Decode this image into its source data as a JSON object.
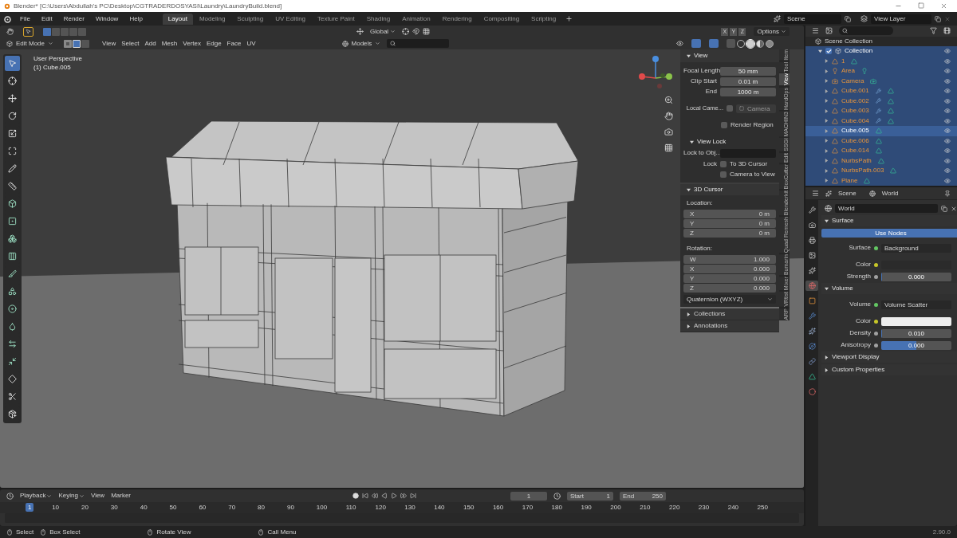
{
  "window": {
    "title": "Blender* [C:\\Users\\Abdullah's PC\\Desktop\\CGTRADERDOSYASI\\Laundry\\LaundryBuild.blend]"
  },
  "menu": [
    "File",
    "Edit",
    "Render",
    "Window",
    "Help"
  ],
  "workspaces": [
    {
      "label": "Layout",
      "selected": true
    },
    {
      "label": "Modeling",
      "selected": false
    },
    {
      "label": "Sculpting",
      "selected": false
    },
    {
      "label": "UV Editing",
      "selected": false
    },
    {
      "label": "Texture Paint",
      "selected": false
    },
    {
      "label": "Shading",
      "selected": false
    },
    {
      "label": "Animation",
      "selected": false
    },
    {
      "label": "Rendering",
      "selected": false
    },
    {
      "label": "Compositing",
      "selected": false
    },
    {
      "label": "Scripting",
      "selected": false
    }
  ],
  "scene": "Scene",
  "view_layer": "View Layer",
  "tool_header": {
    "select_box_modes": [
      {
        "selected": true
      },
      {
        "selected": false
      },
      {
        "selected": false
      },
      {
        "selected": false
      },
      {
        "selected": false
      }
    ],
    "orientation": "Global",
    "axes": [
      "X",
      "Y",
      "Z"
    ],
    "options": "Options"
  },
  "viewport_header": {
    "mode": "Edit Mode",
    "select_modes": [
      {
        "kind": "vertex",
        "selected": false
      },
      {
        "kind": "edge",
        "selected": true
      },
      {
        "kind": "face",
        "selected": false
      }
    ],
    "menus": [
      "View",
      "Select",
      "Add",
      "Mesh",
      "Vertex",
      "Edge",
      "Face",
      "UV"
    ],
    "collection": "Models",
    "shading": [
      {
        "kind": "wireframe",
        "selected": false
      },
      {
        "kind": "solid",
        "selected": true
      },
      {
        "kind": "material",
        "selected": false
      },
      {
        "kind": "rendered",
        "selected": false
      }
    ]
  },
  "viewport": {
    "overlay_lines": [
      "User Perspective",
      "(1) Cube.005"
    ],
    "tools": [
      {
        "kind": "select",
        "selected": true
      },
      {
        "kind": "cursor",
        "selected": false
      },
      {
        "kind": "move",
        "selected": false
      },
      {
        "kind": "rotate",
        "selected": false
      },
      {
        "kind": "scale",
        "selected": false
      },
      {
        "kind": "transform",
        "selected": false
      },
      {
        "kind": "annotate",
        "selected": false
      },
      {
        "kind": "measure",
        "selected": false
      },
      {
        "kind": "extrude",
        "selected": false
      },
      {
        "kind": "inset",
        "selected": false
      },
      {
        "kind": "bevel",
        "selected": false
      },
      {
        "kind": "loopcut",
        "selected": false
      },
      {
        "kind": "knife",
        "selected": false
      },
      {
        "kind": "polybuild",
        "selected": false
      },
      {
        "kind": "spin",
        "selected": false
      },
      {
        "kind": "smooth",
        "selected": false
      },
      {
        "kind": "edgeslide",
        "selected": false
      },
      {
        "kind": "shrink",
        "selected": false
      },
      {
        "kind": "shear",
        "selected": false
      },
      {
        "kind": "rip",
        "selected": false
      },
      {
        "kind": "addcube",
        "selected": false
      }
    ]
  },
  "sidebar": {
    "tabs": [
      {
        "label": "Item",
        "selected": false
      },
      {
        "label": "Tool",
        "selected": false
      },
      {
        "label": "View",
        "selected": true
      },
      {
        "label": "HardOps",
        "selected": false
      },
      {
        "label": "MACHIN3",
        "selected": false
      },
      {
        "label": "SSGI",
        "selected": false
      },
      {
        "label": "Edit",
        "selected": false
      },
      {
        "label": "BoxCutter",
        "selected": false
      },
      {
        "label": "Blenderkit",
        "selected": false
      },
      {
        "label": "Quad Remesh",
        "selected": false
      },
      {
        "label": "Bumarin",
        "selected": false
      },
      {
        "label": "Mixer",
        "selected": false
      },
      {
        "label": "VRtist",
        "selected": false
      },
      {
        "label": "ARP",
        "selected": false
      }
    ],
    "view_panel": {
      "title": "View",
      "fields": [
        {
          "label": "Focal Length",
          "value": "50 mm"
        },
        {
          "label": "Clip Start",
          "value": "0.01 m"
        },
        {
          "label": "End",
          "value": "1000 m"
        }
      ],
      "local_camera": {
        "label": "Local Came...",
        "checked": false,
        "value": "Camera"
      },
      "render_region": {
        "label": "Render Region",
        "checked": false
      },
      "view_lock": {
        "title": "View Lock",
        "lock_to_object": "Lock to Obj...",
        "lock_label": "Lock",
        "options": [
          {
            "label": "To 3D Cursor",
            "checked": false
          },
          {
            "label": "Camera to View",
            "checked": false
          }
        ]
      }
    },
    "cursor_panel": {
      "title": "3D Cursor",
      "location_label": "Location:",
      "location": [
        {
          "axis": "X",
          "value": "0 m"
        },
        {
          "axis": "Y",
          "value": "0 m"
        },
        {
          "axis": "Z",
          "value": "0 m"
        }
      ],
      "rotation_label": "Rotation:",
      "rotation": [
        {
          "axis": "W",
          "value": "1.000"
        },
        {
          "axis": "X",
          "value": "0.000"
        },
        {
          "axis": "Y",
          "value": "0.000"
        },
        {
          "axis": "Z",
          "value": "0.000"
        }
      ],
      "rotation_mode": "Quaternion (WXYZ)"
    },
    "collapsed_panels": [
      "Collections",
      "Annotations"
    ]
  },
  "outliner": {
    "root": "Scene Collection",
    "collection": {
      "name": "Collection",
      "checked": true,
      "expanded": true,
      "children": [
        {
          "name": "1",
          "kind": "mesh",
          "selected": true,
          "active": false,
          "modifier": false
        },
        {
          "name": "Area",
          "kind": "light",
          "selected": true,
          "active": false,
          "modifier": false
        },
        {
          "name": "Camera",
          "kind": "camera",
          "selected": true,
          "active": false,
          "modifier": false
        },
        {
          "name": "Cube.001",
          "kind": "mesh",
          "selected": true,
          "active": false,
          "modifier": true
        },
        {
          "name": "Cube.002",
          "kind": "mesh",
          "selected": true,
          "active": false,
          "modifier": true
        },
        {
          "name": "Cube.003",
          "kind": "mesh",
          "selected": true,
          "active": false,
          "modifier": true
        },
        {
          "name": "Cube.004",
          "kind": "mesh",
          "selected": true,
          "active": false,
          "modifier": true
        },
        {
          "name": "Cube.005",
          "kind": "mesh",
          "selected": true,
          "active": true,
          "modifier": false
        },
        {
          "name": "Cube.006",
          "kind": "mesh",
          "selected": true,
          "active": false,
          "modifier": false
        },
        {
          "name": "Cube.014",
          "kind": "mesh",
          "selected": true,
          "active": false,
          "modifier": false
        },
        {
          "name": "NurbsPath",
          "kind": "mesh",
          "selected": true,
          "active": false,
          "modifier": false
        },
        {
          "name": "NurbsPath.003",
          "kind": "mesh",
          "selected": true,
          "active": false,
          "modifier": false
        },
        {
          "name": "Plane",
          "kind": "mesh",
          "selected": true,
          "active": false,
          "modifier": false
        }
      ]
    }
  },
  "properties": {
    "breadcrumb": [
      "Scene",
      "World"
    ],
    "world": "World",
    "tabs": [
      {
        "kind": "tool",
        "selected": false
      },
      {
        "kind": "render",
        "selected": false
      },
      {
        "kind": "output",
        "selected": false
      },
      {
        "kind": "view_layer",
        "selected": false
      },
      {
        "kind": "scene",
        "selected": false
      },
      {
        "kind": "world",
        "selected": true
      },
      {
        "kind": "object",
        "selected": false
      },
      {
        "kind": "modifiers",
        "selected": false
      },
      {
        "kind": "particles",
        "selected": false
      },
      {
        "kind": "physics",
        "selected": false
      },
      {
        "kind": "constraints",
        "selected": false
      },
      {
        "kind": "data",
        "selected": false
      },
      {
        "kind": "material",
        "selected": false
      }
    ],
    "sections": [
      {
        "title": "Surface",
        "expanded": true,
        "use_nodes": "Use Nodes",
        "rows": [
          {
            "kind": "link",
            "label": "Surface",
            "value": "Background"
          },
          {
            "kind": "color",
            "label": "Color",
            "color": "#2b2b2b"
          },
          {
            "kind": "number",
            "label": "Strength",
            "value": "0.000",
            "level": 0
          }
        ]
      },
      {
        "title": "Volume",
        "expanded": true,
        "rows": [
          {
            "kind": "link",
            "label": "Volume",
            "value": "Volume Scatter"
          },
          {
            "kind": "color",
            "label": "Color",
            "color": "#ededed"
          },
          {
            "kind": "number",
            "label": "Density",
            "value": "0.010",
            "level": 0.01
          },
          {
            "kind": "number",
            "label": "Anisotropy",
            "value": "0.000",
            "level": 0.5
          }
        ]
      },
      {
        "title": "Viewport Display",
        "expanded": false
      },
      {
        "title": "Custom Properties",
        "expanded": false
      }
    ]
  },
  "timeline": {
    "menus": [
      "Playback",
      "Keying",
      "View",
      "Marker"
    ],
    "current_frame": "1",
    "start_label": "Start",
    "start": "1",
    "end_label": "End",
    "end": "250",
    "ruler_current": "1",
    "ruler": [
      "10",
      "20",
      "30",
      "40",
      "50",
      "60",
      "70",
      "80",
      "90",
      "100",
      "110",
      "120",
      "130",
      "140",
      "150",
      "160",
      "170",
      "180",
      "190",
      "200",
      "210",
      "220",
      "230",
      "240",
      "250"
    ]
  },
  "status_bar": {
    "hints": [
      "Select",
      "Box Select",
      "Rotate View",
      "Call Menu"
    ],
    "version": "2.90.0"
  }
}
